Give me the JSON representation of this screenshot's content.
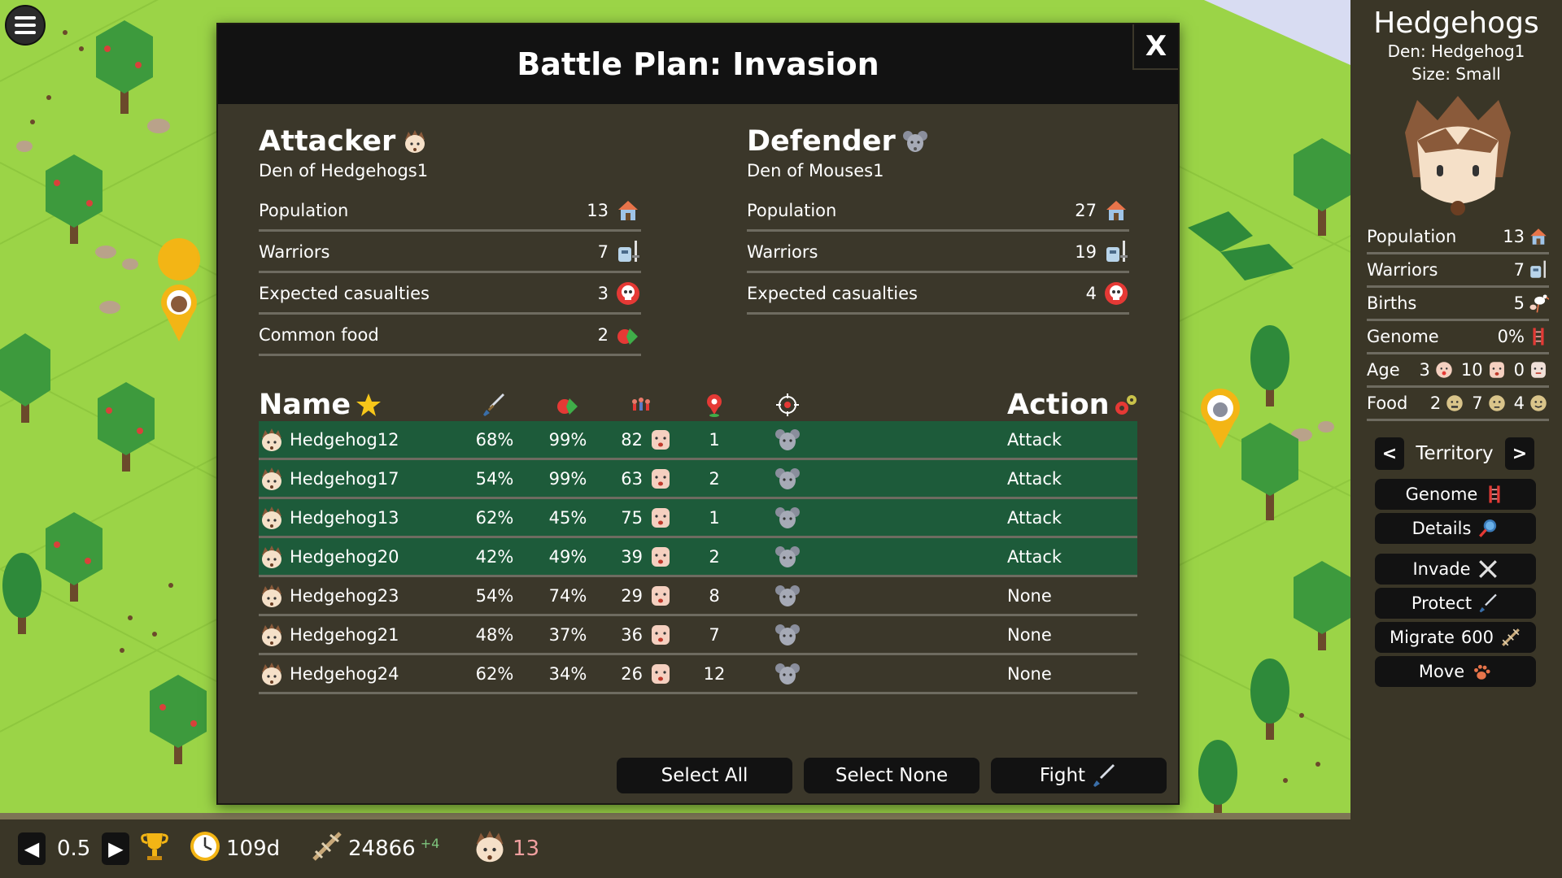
{
  "dialog": {
    "title": "Battle Plan: Invasion",
    "close_label": "X",
    "attacker": {
      "title": "Attacker",
      "den": "Den of Hedgehogs1",
      "stats": [
        {
          "label": "Population",
          "value": "13",
          "icon": "house-icon"
        },
        {
          "label": "Warriors",
          "value": "7",
          "icon": "warrior-icon"
        },
        {
          "label": "Expected casualties",
          "value": "3",
          "icon": "skull-icon"
        },
        {
          "label": "Common food",
          "value": "2",
          "icon": "food-icon"
        }
      ]
    },
    "defender": {
      "title": "Defender",
      "den": "Den of Mouses1",
      "stats": [
        {
          "label": "Population",
          "value": "27",
          "icon": "house-icon"
        },
        {
          "label": "Warriors",
          "value": "19",
          "icon": "warrior-icon"
        },
        {
          "label": "Expected casualties",
          "value": "4",
          "icon": "skull-icon"
        }
      ]
    },
    "table": {
      "name_header": "Name",
      "action_header": "Action",
      "rows": [
        {
          "name": "Hedgehog12",
          "attack": "68%",
          "food": "99%",
          "age": "82",
          "distance": "1",
          "action": "Attack",
          "selected": true
        },
        {
          "name": "Hedgehog17",
          "attack": "54%",
          "food": "99%",
          "age": "63",
          "distance": "2",
          "action": "Attack",
          "selected": true
        },
        {
          "name": "Hedgehog13",
          "attack": "62%",
          "food": "45%",
          "age": "75",
          "distance": "1",
          "action": "Attack",
          "selected": true
        },
        {
          "name": "Hedgehog20",
          "attack": "42%",
          "food": "49%",
          "age": "39",
          "distance": "2",
          "action": "Attack",
          "selected": true
        },
        {
          "name": "Hedgehog23",
          "attack": "54%",
          "food": "74%",
          "age": "29",
          "distance": "8",
          "action": "None",
          "selected": false
        },
        {
          "name": "Hedgehog21",
          "attack": "48%",
          "food": "37%",
          "age": "36",
          "distance": "7",
          "action": "None",
          "selected": false
        },
        {
          "name": "Hedgehog24",
          "attack": "62%",
          "food": "34%",
          "age": "26",
          "distance": "12",
          "action": "None",
          "selected": false
        }
      ]
    },
    "buttons": {
      "select_all": "Select All",
      "select_none": "Select None",
      "fight": "Fight"
    }
  },
  "panel": {
    "title": "Hedgehogs",
    "den": "Den: Hedgehog1",
    "size": "Size: Small",
    "population_label": "Population",
    "population": "13",
    "warriors_label": "Warriors",
    "warriors": "7",
    "births_label": "Births",
    "births": "5",
    "genome_label": "Genome",
    "genome": "0%",
    "age_label": "Age",
    "age_young": "3",
    "age_adult": "10",
    "age_old": "0",
    "food_label": "Food",
    "food_a": "2",
    "food_b": "7",
    "food_c": "4",
    "territory_label": "Territory",
    "prev": "<",
    "next": ">",
    "buttons": {
      "genome": "Genome",
      "details": "Details",
      "invade": "Invade",
      "protect": "Protect",
      "migrate": "Migrate",
      "migrate_cost": "600",
      "move": "Move"
    }
  },
  "bottom": {
    "speed": "0.5",
    "days": "109d",
    "dna": "24866",
    "dna_delta": "+4",
    "hedgehogs": "13"
  },
  "colors": {
    "selected_row": "#1d5b3a",
    "panel_bg": "#3a3627",
    "dialog_bg": "#3b372a",
    "grass": "#9bd447"
  }
}
